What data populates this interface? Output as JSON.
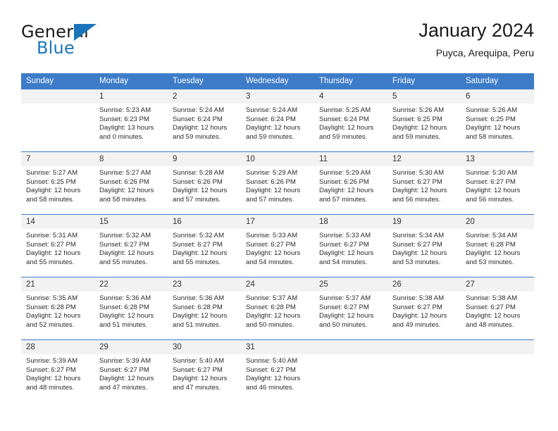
{
  "brand": {
    "name_top": "General",
    "name_bottom": "Blue",
    "accent_color": "#1b75bb",
    "triangle_icon": "blue-triangle-logo-mark"
  },
  "header": {
    "title": "January 2024",
    "subtitle": "Puyca, Arequipa, Peru"
  },
  "calendar": {
    "header_bg": "#3d7cc9",
    "daynum_bg": "#f2f2f2",
    "weekdays": [
      "Sunday",
      "Monday",
      "Tuesday",
      "Wednesday",
      "Thursday",
      "Friday",
      "Saturday"
    ],
    "weeks": [
      [
        {
          "day": "",
          "lines": []
        },
        {
          "day": "1",
          "lines": [
            "Sunrise: 5:23 AM",
            "Sunset: 6:23 PM",
            "Daylight: 13 hours",
            "and 0 minutes."
          ]
        },
        {
          "day": "2",
          "lines": [
            "Sunrise: 5:24 AM",
            "Sunset: 6:24 PM",
            "Daylight: 12 hours",
            "and 59 minutes."
          ]
        },
        {
          "day": "3",
          "lines": [
            "Sunrise: 5:24 AM",
            "Sunset: 6:24 PM",
            "Daylight: 12 hours",
            "and 59 minutes."
          ]
        },
        {
          "day": "4",
          "lines": [
            "Sunrise: 5:25 AM",
            "Sunset: 6:24 PM",
            "Daylight: 12 hours",
            "and 59 minutes."
          ]
        },
        {
          "day": "5",
          "lines": [
            "Sunrise: 5:26 AM",
            "Sunset: 6:25 PM",
            "Daylight: 12 hours",
            "and 59 minutes."
          ]
        },
        {
          "day": "6",
          "lines": [
            "Sunrise: 5:26 AM",
            "Sunset: 6:25 PM",
            "Daylight: 12 hours",
            "and 58 minutes."
          ]
        }
      ],
      [
        {
          "day": "7",
          "lines": [
            "Sunrise: 5:27 AM",
            "Sunset: 6:25 PM",
            "Daylight: 12 hours",
            "and 58 minutes."
          ]
        },
        {
          "day": "8",
          "lines": [
            "Sunrise: 5:27 AM",
            "Sunset: 6:26 PM",
            "Daylight: 12 hours",
            "and 58 minutes."
          ]
        },
        {
          "day": "9",
          "lines": [
            "Sunrise: 5:28 AM",
            "Sunset: 6:26 PM",
            "Daylight: 12 hours",
            "and 57 minutes."
          ]
        },
        {
          "day": "10",
          "lines": [
            "Sunrise: 5:29 AM",
            "Sunset: 6:26 PM",
            "Daylight: 12 hours",
            "and 57 minutes."
          ]
        },
        {
          "day": "11",
          "lines": [
            "Sunrise: 5:29 AM",
            "Sunset: 6:26 PM",
            "Daylight: 12 hours",
            "and 57 minutes."
          ]
        },
        {
          "day": "12",
          "lines": [
            "Sunrise: 5:30 AM",
            "Sunset: 6:27 PM",
            "Daylight: 12 hours",
            "and 56 minutes."
          ]
        },
        {
          "day": "13",
          "lines": [
            "Sunrise: 5:30 AM",
            "Sunset: 6:27 PM",
            "Daylight: 12 hours",
            "and 56 minutes."
          ]
        }
      ],
      [
        {
          "day": "14",
          "lines": [
            "Sunrise: 5:31 AM",
            "Sunset: 6:27 PM",
            "Daylight: 12 hours",
            "and 55 minutes."
          ]
        },
        {
          "day": "15",
          "lines": [
            "Sunrise: 5:32 AM",
            "Sunset: 6:27 PM",
            "Daylight: 12 hours",
            "and 55 minutes."
          ]
        },
        {
          "day": "16",
          "lines": [
            "Sunrise: 5:32 AM",
            "Sunset: 6:27 PM",
            "Daylight: 12 hours",
            "and 55 minutes."
          ]
        },
        {
          "day": "17",
          "lines": [
            "Sunrise: 5:33 AM",
            "Sunset: 6:27 PM",
            "Daylight: 12 hours",
            "and 54 minutes."
          ]
        },
        {
          "day": "18",
          "lines": [
            "Sunrise: 5:33 AM",
            "Sunset: 6:27 PM",
            "Daylight: 12 hours",
            "and 54 minutes."
          ]
        },
        {
          "day": "19",
          "lines": [
            "Sunrise: 5:34 AM",
            "Sunset: 6:27 PM",
            "Daylight: 12 hours",
            "and 53 minutes."
          ]
        },
        {
          "day": "20",
          "lines": [
            "Sunrise: 5:34 AM",
            "Sunset: 6:28 PM",
            "Daylight: 12 hours",
            "and 53 minutes."
          ]
        }
      ],
      [
        {
          "day": "21",
          "lines": [
            "Sunrise: 5:35 AM",
            "Sunset: 6:28 PM",
            "Daylight: 12 hours",
            "and 52 minutes."
          ]
        },
        {
          "day": "22",
          "lines": [
            "Sunrise: 5:36 AM",
            "Sunset: 6:28 PM",
            "Daylight: 12 hours",
            "and 51 minutes."
          ]
        },
        {
          "day": "23",
          "lines": [
            "Sunrise: 5:36 AM",
            "Sunset: 6:28 PM",
            "Daylight: 12 hours",
            "and 51 minutes."
          ]
        },
        {
          "day": "24",
          "lines": [
            "Sunrise: 5:37 AM",
            "Sunset: 6:28 PM",
            "Daylight: 12 hours",
            "and 50 minutes."
          ]
        },
        {
          "day": "25",
          "lines": [
            "Sunrise: 5:37 AM",
            "Sunset: 6:27 PM",
            "Daylight: 12 hours",
            "and 50 minutes."
          ]
        },
        {
          "day": "26",
          "lines": [
            "Sunrise: 5:38 AM",
            "Sunset: 6:27 PM",
            "Daylight: 12 hours",
            "and 49 minutes."
          ]
        },
        {
          "day": "27",
          "lines": [
            "Sunrise: 5:38 AM",
            "Sunset: 6:27 PM",
            "Daylight: 12 hours",
            "and 48 minutes."
          ]
        }
      ],
      [
        {
          "day": "28",
          "lines": [
            "Sunrise: 5:39 AM",
            "Sunset: 6:27 PM",
            "Daylight: 12 hours",
            "and 48 minutes."
          ]
        },
        {
          "day": "29",
          "lines": [
            "Sunrise: 5:39 AM",
            "Sunset: 6:27 PM",
            "Daylight: 12 hours",
            "and 47 minutes."
          ]
        },
        {
          "day": "30",
          "lines": [
            "Sunrise: 5:40 AM",
            "Sunset: 6:27 PM",
            "Daylight: 12 hours",
            "and 47 minutes."
          ]
        },
        {
          "day": "31",
          "lines": [
            "Sunrise: 5:40 AM",
            "Sunset: 6:27 PM",
            "Daylight: 12 hours",
            "and 46 minutes."
          ]
        },
        {
          "day": "",
          "lines": []
        },
        {
          "day": "",
          "lines": []
        },
        {
          "day": "",
          "lines": []
        }
      ]
    ]
  }
}
